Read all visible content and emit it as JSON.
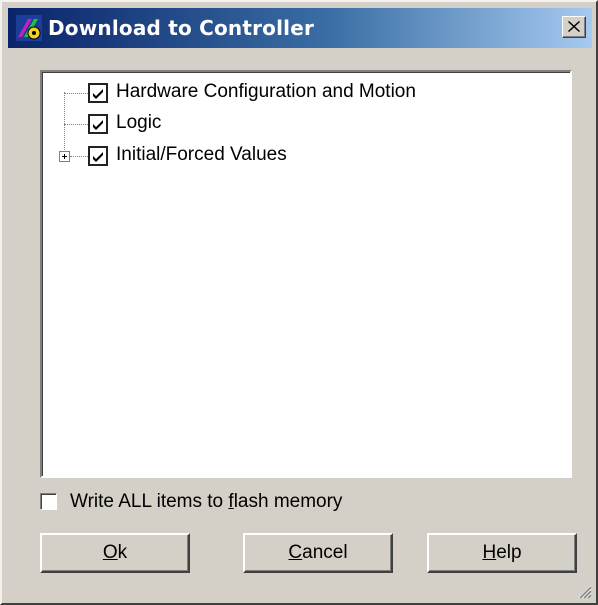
{
  "window": {
    "title": "Download to Controller",
    "close_symbol": "×"
  },
  "tree": {
    "items": [
      {
        "label": "Hardware Configuration and Motion",
        "checked": true,
        "expandable": false
      },
      {
        "label": "Logic",
        "checked": true,
        "expandable": false
      },
      {
        "label": "Initial/Forced Values",
        "checked": true,
        "expandable": true
      }
    ]
  },
  "flash_option": {
    "label_before": "Write ALL items to ",
    "label_mnemonic": "f",
    "label_after": "lash memory",
    "checked": false
  },
  "buttons": {
    "ok": {
      "mnemonic": "O",
      "rest": "k"
    },
    "cancel": {
      "mnemonic": "C",
      "rest": "ancel"
    },
    "help": {
      "mnemonic": "H",
      "rest": "elp"
    }
  },
  "icons": {
    "app": "controller-app-icon",
    "close": "close-icon",
    "checkbox": "checkmark-icon",
    "expander": "plus-expander-icon",
    "grip": "resize-grip-icon"
  },
  "colors": {
    "title_gradient_start": "#0a246a",
    "title_gradient_end": "#a6caf0",
    "dialog_face": "#d4d0c8"
  }
}
